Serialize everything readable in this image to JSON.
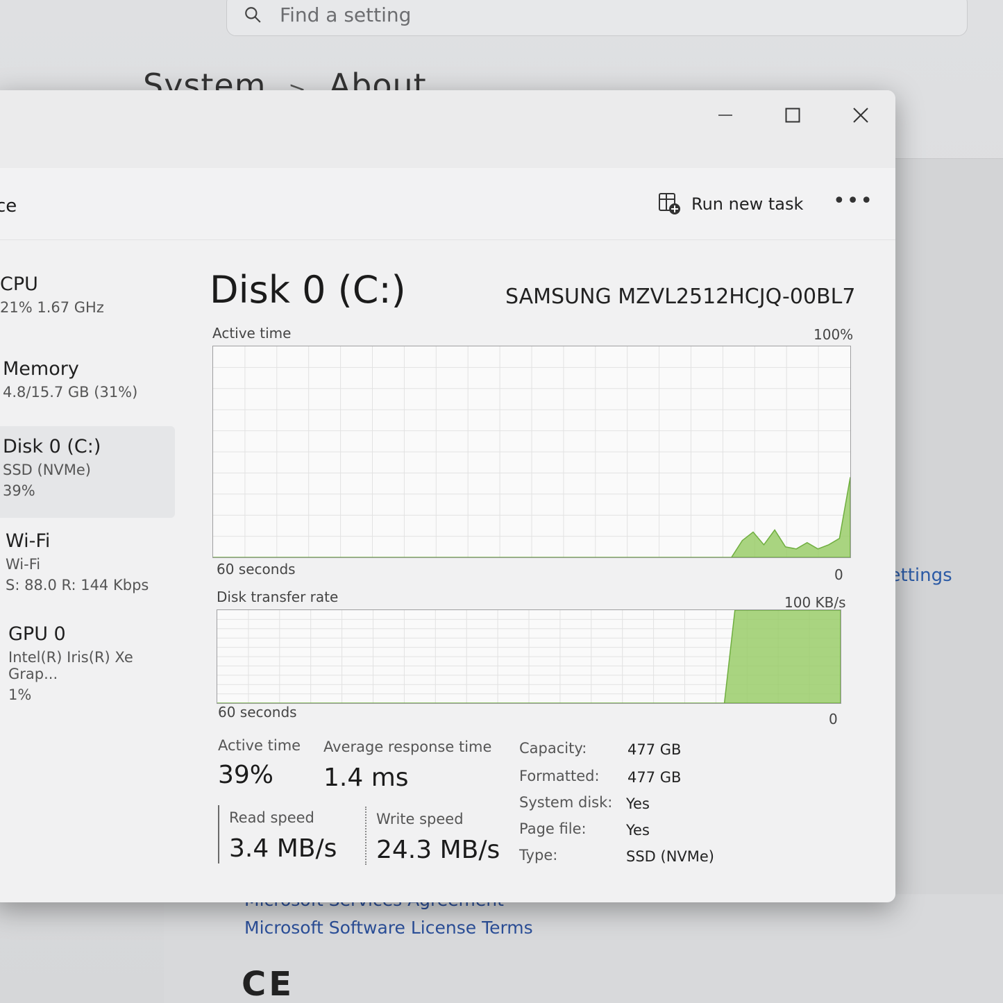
{
  "settings": {
    "search_placeholder": "Find a setting",
    "breadcrumb_parent": "System",
    "breadcrumb_sep": ">",
    "breadcrumb_current": "About",
    "right_link": "settings",
    "legal_links": [
      "Microsoft Services Agreement",
      "Microsoft Software License Terms"
    ],
    "ce_mark": "CE"
  },
  "task_manager": {
    "toolbar_title": "ce",
    "run_new_task_label": "Run new task",
    "more_label": "•••",
    "sidebar": [
      {
        "name": "CPU",
        "sub1": "21%  1.67 GHz",
        "sub2": ""
      },
      {
        "name": "Memory",
        "sub1": "4.8/15.7 GB (31%)",
        "sub2": ""
      },
      {
        "name": "Disk 0 (C:)",
        "sub1": "SSD (NVMe)",
        "sub2": "39%"
      },
      {
        "name": "Wi-Fi",
        "sub1": "Wi-Fi",
        "sub2": "S: 88.0  R: 144 Kbps"
      },
      {
        "name": "GPU 0",
        "sub1": "Intel(R) Iris(R) Xe Grap...",
        "sub2": "1%"
      }
    ],
    "disk_title": "Disk 0 (C:)",
    "disk_model": "SAMSUNG MZVL2512HCJQ-00BL7",
    "active_chart": {
      "label": "Active time",
      "max_label": "100%",
      "x_label": "60 seconds",
      "min_label": "0",
      "color": "#9acd6a",
      "values": [
        0,
        0,
        0,
        0,
        0,
        0,
        0,
        0,
        0,
        0,
        0,
        0,
        0,
        0,
        0,
        0,
        0,
        0,
        0,
        0,
        0,
        0,
        0,
        0,
        0,
        0,
        0,
        0,
        0,
        0,
        0,
        0,
        0,
        0,
        0,
        0,
        0,
        0,
        0,
        0,
        0,
        0,
        0,
        0,
        0,
        0,
        0,
        0,
        0,
        8,
        12,
        6,
        13,
        5,
        4,
        7,
        4,
        6,
        9,
        38
      ]
    },
    "transfer_chart": {
      "label": "Disk transfer rate",
      "max_label": "100 KB/s",
      "x_label": "60 seconds",
      "min_label": "0",
      "color": "#9acd6a",
      "values": [
        0,
        0,
        0,
        0,
        0,
        0,
        0,
        0,
        0,
        0,
        0,
        0,
        0,
        0,
        0,
        0,
        0,
        0,
        0,
        0,
        0,
        0,
        0,
        0,
        0,
        0,
        0,
        0,
        0,
        0,
        0,
        0,
        0,
        0,
        0,
        0,
        0,
        0,
        0,
        0,
        0,
        0,
        0,
        0,
        0,
        0,
        0,
        0,
        0,
        100,
        100,
        100,
        100,
        100,
        100,
        100,
        100,
        100,
        100,
        100
      ]
    },
    "stats": {
      "active_time_label": "Active time",
      "active_time_value": "39%",
      "avg_response_label": "Average response time",
      "avg_response_value": "1.4 ms",
      "read_label": "Read speed",
      "read_value": "3.4 MB/s",
      "write_label": "Write speed",
      "write_value": "24.3 MB/s"
    },
    "properties": [
      {
        "key": "Capacity:",
        "value": "477 GB"
      },
      {
        "key": "Formatted:",
        "value": "477 GB"
      },
      {
        "key": "System disk:",
        "value": "Yes"
      },
      {
        "key": "Page file:",
        "value": "Yes"
      },
      {
        "key": "Type:",
        "value": "SSD (NVMe)"
      }
    ]
  }
}
